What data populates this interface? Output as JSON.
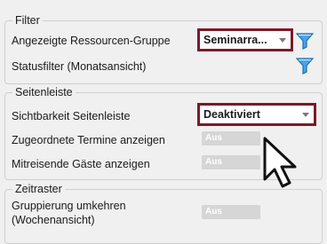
{
  "filter": {
    "title": "Filter",
    "resource_group_label": "Angezeigte Ressourcen-Gruppe",
    "resource_group_value": "Seminarra...",
    "status_filter_label": "Statusfilter (Monatsansicht)"
  },
  "sidebar": {
    "title": "Seitenleiste",
    "visibility_label": "Sichtbarkeit Seitenleiste",
    "visibility_value": "Deaktiviert",
    "assigned_appointments_label": "Zugeordnete Termine anzeigen",
    "assigned_appointments_toggle": "Aus",
    "traveling_guests_label": "Mitreisende Gäste anzeigen",
    "traveling_guests_toggle": "Aus"
  },
  "timegrid": {
    "title": "Zeitraster",
    "reverse_grouping_label_line1": "Gruppierung umkehren",
    "reverse_grouping_label_line2": "(Wochenansicht)",
    "reverse_grouping_toggle": "Aus"
  },
  "colors": {
    "highlight": "#7a1a2a",
    "filter_icon": "#2f8fd8"
  }
}
